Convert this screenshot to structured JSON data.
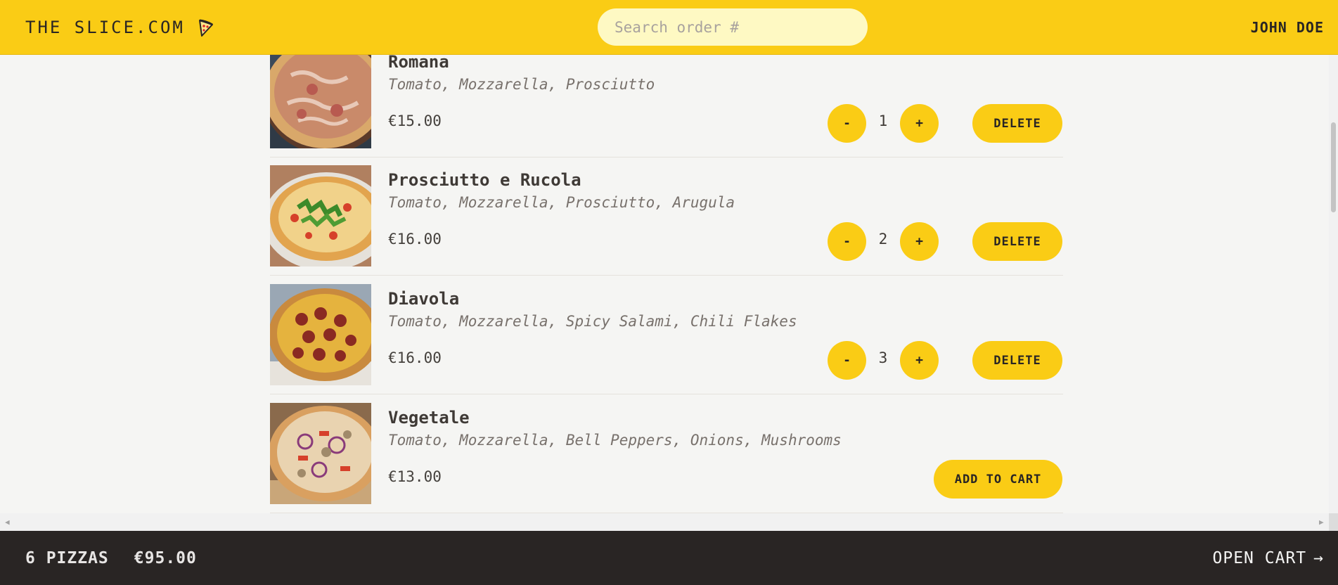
{
  "header": {
    "logo": "THE SLICE.COM",
    "search_placeholder": "Search order #",
    "user": "JOHN DOE"
  },
  "pizzas": [
    {
      "name": "Romana",
      "ingredients": "Tomato, Mozzarella, Prosciutto",
      "price": "€15.00",
      "quantity": "1",
      "action": "DELETE"
    },
    {
      "name": "Prosciutto e Rucola",
      "ingredients": "Tomato, Mozzarella, Prosciutto, Arugula",
      "price": "€16.00",
      "quantity": "2",
      "action": "DELETE"
    },
    {
      "name": "Diavola",
      "ingredients": "Tomato, Mozzarella, Spicy Salami, Chili Flakes",
      "price": "€16.00",
      "quantity": "3",
      "action": "DELETE"
    },
    {
      "name": "Vegetale",
      "ingredients": "Tomato, Mozzarella, Bell Peppers, Onions, Mushrooms",
      "price": "€13.00",
      "action": "ADD TO CART"
    }
  ],
  "qty_controls": {
    "decrease": "-",
    "increase": "+"
  },
  "footer": {
    "pizza_count": "6 PIZZAS",
    "total": "€95.00",
    "open_cart": "OPEN CART",
    "arrow": "→"
  },
  "colors": {
    "accent": "#facc15",
    "footer_bg": "#292524",
    "page_bg": "#f5f5f3"
  },
  "icons": {
    "logo": "pizza-slice-icon",
    "thumbnails": "pizza-photo"
  }
}
